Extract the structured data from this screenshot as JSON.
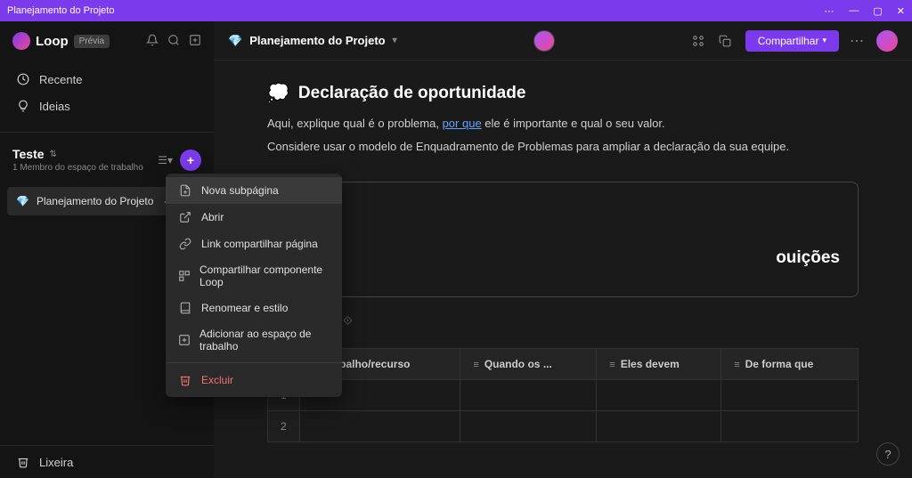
{
  "titlebar": {
    "title": "Planejamento do Projeto"
  },
  "app": {
    "name": "Loop",
    "badge": "Prévia"
  },
  "sidebar_nav": {
    "recent": "Recente",
    "ideas": "Ideias"
  },
  "workspace": {
    "name": "Teste",
    "subtitle": "1 Membro do espaço de trabalho"
  },
  "page_item": {
    "name": "Planejamento do Projeto"
  },
  "trash": {
    "label": "Lixeira"
  },
  "breadcrumb": {
    "title": "Planejamento do Projeto"
  },
  "share_button": {
    "label": "Compartilhar"
  },
  "section": {
    "emoji": "💭",
    "title": "Declaração de oportunidade",
    "line1_a": "Aqui, explique qual é o problema, ",
    "line1_link": "por que",
    "line1_b": " ele é importante e qual o seu valor.",
    "line2": "Considere usar o modelo de Enquadramento de Problemas para ampliar a declaração da sua equipe."
  },
  "partial_heading": "ouições",
  "table": {
    "headers": [
      "Trabalho/recurso",
      "Quando os ...",
      "Eles devem",
      "De forma que"
    ],
    "rows": [
      "1",
      "2"
    ]
  },
  "context_menu": {
    "new_subpage": "Nova subpágina",
    "open": "Abrir",
    "share_link": "Link compartilhar página",
    "share_component": "Compartilhar componente Loop",
    "rename": "Renomear e estilo",
    "add_workspace": "Adicionar ao espaço de trabalho",
    "delete": "Excluir"
  },
  "help": "?"
}
